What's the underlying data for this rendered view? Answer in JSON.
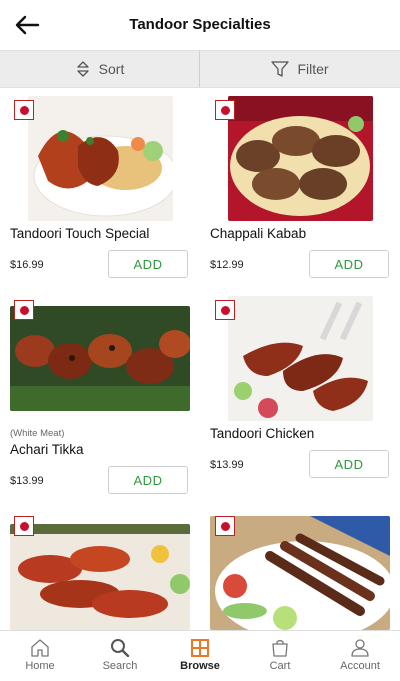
{
  "header": {
    "title": "Tandoor Specialties",
    "back_icon": "arrow-left-icon"
  },
  "toolbar": {
    "sort_label": "Sort",
    "filter_label": "Filter",
    "sort_icon": "sort-icon",
    "filter_icon": "filter-icon"
  },
  "menu_items": [
    {
      "name": "Tandoori Touch Special",
      "note": "",
      "price": "$16.99",
      "add_label": "ADD"
    },
    {
      "name": "Chappali Kabab",
      "note": "",
      "price": "$12.99",
      "add_label": "ADD"
    },
    {
      "name": "Achari Tikka",
      "note": "(White Meat)",
      "price": "$13.99",
      "add_label": "ADD"
    },
    {
      "name": "Tandoori Chicken",
      "note": "",
      "price": "$13.99",
      "add_label": "ADD"
    },
    {
      "name": "",
      "note": "",
      "price": "",
      "add_label": ""
    },
    {
      "name": "",
      "note": "",
      "price": "",
      "add_label": ""
    }
  ],
  "bottom_nav": [
    {
      "label": "Home",
      "icon": "home-icon"
    },
    {
      "label": "Search",
      "icon": "search-icon"
    },
    {
      "label": "Browse",
      "icon": "grid-icon",
      "active": true
    },
    {
      "label": "Cart",
      "icon": "cart-icon"
    },
    {
      "label": "Account",
      "icon": "account-icon"
    }
  ],
  "colors": {
    "accent_green": "#2e9a3e",
    "active_orange": "#e8792b",
    "badge_red": "#c8102e"
  }
}
